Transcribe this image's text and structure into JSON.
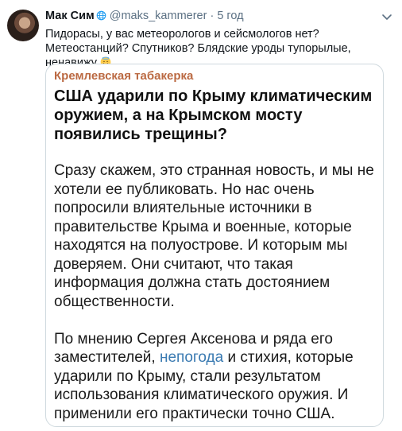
{
  "tweet": {
    "author_name": "Мак Сим",
    "handle": "@maks_kammerer",
    "separator": "·",
    "time": "5 год",
    "text": "Пидорасы, у вас метеорологов и сейсмологов нет? Метеостанций? Спутников? Блядские уроды тупорылые, ненавижу",
    "avatar_icon": "user-avatar",
    "verified_icon": "globe-icon",
    "emoji_icon": "smiling-face-icon",
    "more_icon": "chevron-down-icon"
  },
  "card": {
    "source": "Кремлевская табакерка",
    "headline": "США ударили по Крыму климатическим оружием, а на Крымском мосту появились трещины?",
    "paragraph1": "Сразу скажем, это странная новость, и мы не хотели ее публиковать. Но нас очень попросили влиятельные источники в правительстве Крыма и военные, которые находятся на полуострове. И которым мы доверяем. Они считают, что такая информация должна стать достоянием общественности.",
    "paragraph2_before": "По мнению Сергея Аксенова и ряда его заместителей, ",
    "paragraph2_link": "непогода",
    "paragraph2_after": " и стихия, которые ударили по Крыму, стали результатом использования климатического оружия. И применили его практически точно США."
  },
  "colors": {
    "source": "#bb6a43",
    "link": "#3b7bb2",
    "muted": "#5b7083",
    "border": "#cfd9de"
  }
}
